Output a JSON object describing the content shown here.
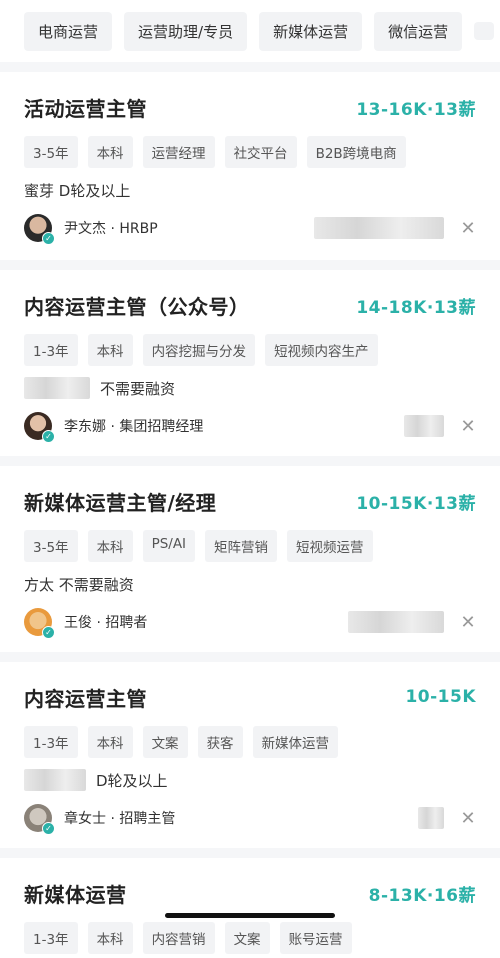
{
  "filters": [
    "电商运营",
    "运营助理/专员",
    "新媒体运营",
    "微信运营"
  ],
  "jobs": [
    {
      "title": "活动运营主管",
      "salary": "13-16K·13薪",
      "tags": [
        "3-5年",
        "本科",
        "运营经理",
        "社交平台",
        "B2B跨境电商"
      ],
      "company": "蜜芽  D轮及以上",
      "recruiter": "尹文杰 · HRBP"
    },
    {
      "title": "内容运营主管（公众号）",
      "salary": "14-18K·13薪",
      "tags": [
        "1-3年",
        "本科",
        "内容挖掘与分发",
        "短视频内容生产"
      ],
      "company": "不需要融资",
      "recruiter": "李东娜 · 集团招聘经理"
    },
    {
      "title": "新媒体运营主管/经理",
      "salary": "10-15K·13薪",
      "tags": [
        "3-5年",
        "本科",
        "PS/AI",
        "矩阵营销",
        "短视频运营"
      ],
      "company": "方太  不需要融资",
      "recruiter": "王俊 · 招聘者"
    },
    {
      "title": "内容运营主管",
      "salary": "10-15K",
      "tags": [
        "1-3年",
        "本科",
        "文案",
        "获客",
        "新媒体运营"
      ],
      "company": "D轮及以上",
      "recruiter": "章女士 · 招聘主管"
    },
    {
      "title": "新媒体运营",
      "salary": "8-13K·16薪",
      "tags": [
        "1-3年",
        "本科",
        "内容营销",
        "文案",
        "账号运营"
      ]
    }
  ],
  "close_glyph": "✕"
}
